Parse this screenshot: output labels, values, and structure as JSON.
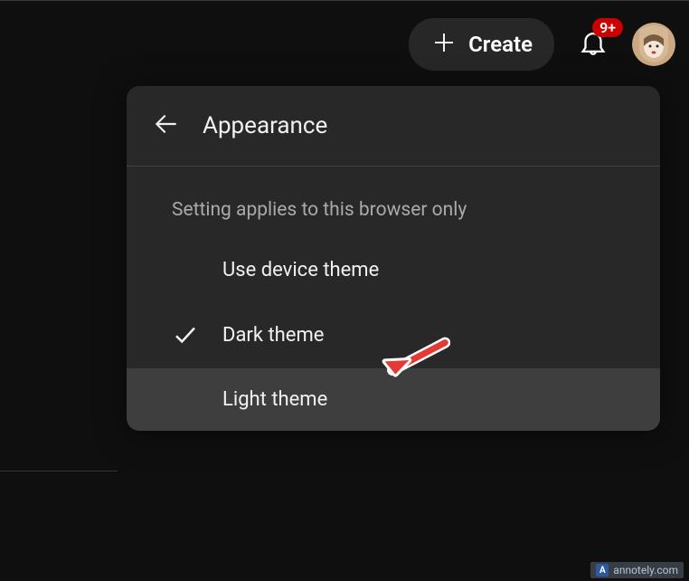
{
  "header": {
    "create_label": "Create",
    "badge_count": "9+"
  },
  "menu": {
    "title": "Appearance",
    "hint": "Setting applies to this browser only",
    "items": [
      {
        "label": "Use device theme",
        "checked": false
      },
      {
        "label": "Dark theme",
        "checked": true
      },
      {
        "label": "Light theme",
        "checked": false
      }
    ]
  },
  "footer": {
    "brand": "annotely.com",
    "logo_letter": "A"
  }
}
